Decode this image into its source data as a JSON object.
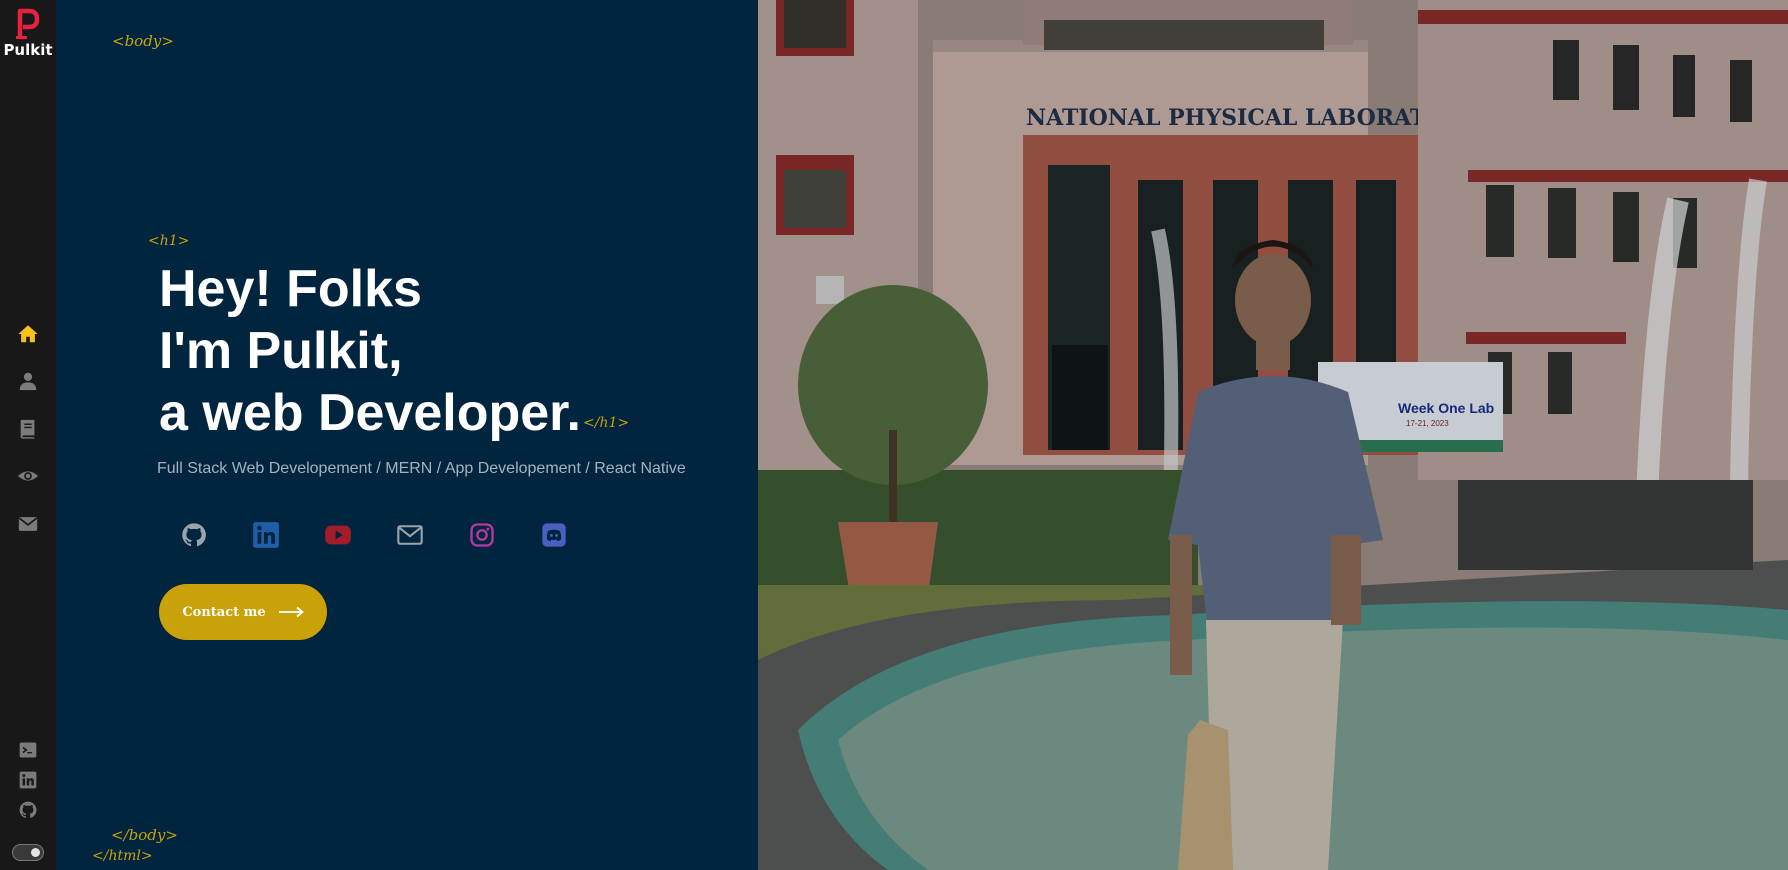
{
  "brand": {
    "logo_letter": "P",
    "name": "Pulkit",
    "logo_color": "#e8223e"
  },
  "sidebar": {
    "nav": [
      {
        "icon": "home-icon",
        "active": true
      },
      {
        "icon": "user-icon",
        "active": false
      },
      {
        "icon": "book-icon",
        "active": false
      },
      {
        "icon": "eye-icon",
        "active": false
      },
      {
        "icon": "mail-icon",
        "active": false
      }
    ],
    "footer_links": [
      "terminal-icon",
      "linkedin-icon",
      "github-icon"
    ],
    "active_color": "#f7c11a",
    "theme_toggle": "dark"
  },
  "tags": {
    "body_open": "<body>",
    "h1_open": "<h1>",
    "h1_close": "</h1>",
    "body_close": "</body>",
    "html_close": "</html>"
  },
  "hero": {
    "line1": "Hey! Folks",
    "line2": "I'm Pulkit,",
    "line3": "a web Developer.",
    "subtitle": "Full Stack Web Developement / MERN / App Developement / React Native"
  },
  "socials": [
    {
      "icon": "github-icon",
      "color": "#9aa4ad"
    },
    {
      "icon": "linkedin-icon",
      "color": "#1f5fa8"
    },
    {
      "icon": "youtube-icon",
      "color": "#a31c2a"
    },
    {
      "icon": "mail-icon",
      "color": "#9aa4ad"
    },
    {
      "icon": "instagram-icon",
      "color": "#b23aa0"
    },
    {
      "icon": "discord-icon",
      "color": "#4b5fc2"
    }
  ],
  "contact_button": {
    "label": "Contact me",
    "color": "#c9a20a"
  },
  "photo": {
    "building_sign": "NATIONAL PHYSICAL LABORATORY",
    "banner_text": "Week One Lab",
    "banner_date": "17-21, 2023"
  },
  "colors": {
    "background": "#02253f",
    "sidebar": "#181818",
    "accent": "#c9a20a"
  }
}
